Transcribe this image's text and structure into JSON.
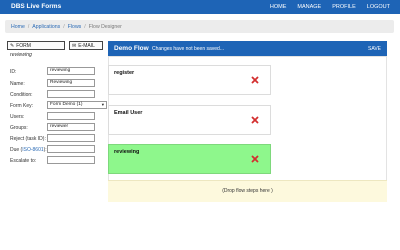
{
  "app": {
    "title": "DBS Live Forms"
  },
  "nav": {
    "home": "HOME",
    "manage": "MANAGE",
    "profile": "PROFILE",
    "logout": "LOGOUT"
  },
  "breadcrumb": {
    "home": "Home",
    "applications": "Applications",
    "flows": "Flows",
    "current": "Flow Designer"
  },
  "toolbar": {
    "form_label": "FORM",
    "email_label": "E-MAIL",
    "form_icon": "edit-icon",
    "email_icon": "envelope-icon"
  },
  "subtitle": "reviewing",
  "form": {
    "id": {
      "label": "ID:",
      "value": "reviewing"
    },
    "name": {
      "label": "Name:",
      "value": "Reviewing"
    },
    "condition": {
      "label": "Condition:",
      "value": ""
    },
    "form_key": {
      "label": "Form Key:",
      "value": "Form Demo (1)"
    },
    "users": {
      "label": "Users:",
      "value": ""
    },
    "groups": {
      "label": "Groups:",
      "value": "reviewer"
    },
    "reject": {
      "label": "Reject (task ID):",
      "value": ""
    },
    "due": {
      "label_prefix": "Due (",
      "label_link": "ISO-8601",
      "label_suffix": "):",
      "value": ""
    },
    "escalate": {
      "label": "Escalate to:",
      "value": ""
    }
  },
  "panel": {
    "title": "Demo Flow",
    "message": "Changes have not been saved...",
    "save_label": "SAVE",
    "steps": [
      {
        "label": "register",
        "highlighted": false
      },
      {
        "label": "Email User",
        "highlighted": false
      },
      {
        "label": "reviewing",
        "highlighted": true
      }
    ],
    "drop_text": "(Drop flow steps here )"
  },
  "colors": {
    "primary": "#1e64b6",
    "delete": "#d32f2f",
    "highlight": "#8ef78c",
    "drop_zone": "#fdf9dd"
  }
}
